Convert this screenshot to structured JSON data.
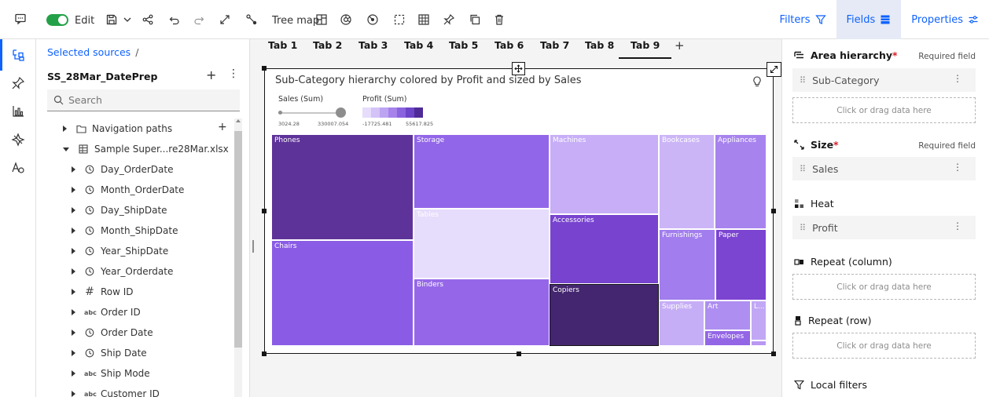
{
  "toolbar": {
    "edit_label": "Edit",
    "viz_type_label": "Tree map",
    "right_tabs": [
      {
        "label": "Filters",
        "icon": "filter-icon",
        "active": false
      },
      {
        "label": "Fields",
        "icon": "fields-icon",
        "active": true
      },
      {
        "label": "Properties",
        "icon": "properties-icon",
        "active": false
      }
    ]
  },
  "sources": {
    "title": "Selected sources",
    "separator": "/",
    "dataset_name": "SS_28Mar_DatePrep",
    "search_placeholder": "Search",
    "tree": [
      {
        "label": "Navigation paths",
        "icon": "folder-icon",
        "expanded": false,
        "level": 0
      },
      {
        "label": "Sample Super...re28Mar.xlsx",
        "icon": "table-icon",
        "expanded": true,
        "level": 0
      },
      {
        "label": "Day_OrderDate",
        "icon": "clock-icon",
        "level": 1
      },
      {
        "label": "Month_OrderDate",
        "icon": "clock-icon",
        "level": 1
      },
      {
        "label": "Day_ShipDate",
        "icon": "clock-icon",
        "level": 1
      },
      {
        "label": "Month_ShipDate",
        "icon": "clock-icon",
        "level": 1
      },
      {
        "label": "Year_ShipDate",
        "icon": "clock-icon",
        "level": 1
      },
      {
        "label": "Year_Orderdate",
        "icon": "clock-icon",
        "level": 1
      },
      {
        "label": "Row ID",
        "icon": "hash-icon",
        "level": 1
      },
      {
        "label": "Order ID",
        "icon": "abc-icon",
        "level": 1
      },
      {
        "label": "Order Date",
        "icon": "clock-icon",
        "level": 1
      },
      {
        "label": "Ship Date",
        "icon": "clock-icon",
        "level": 1
      },
      {
        "label": "Ship Mode",
        "icon": "abc-icon",
        "level": 1
      },
      {
        "label": "Customer ID",
        "icon": "abc-icon",
        "level": 1
      }
    ]
  },
  "tabs": {
    "items": [
      "Tab 1",
      "Tab 2",
      "Tab 3",
      "Tab 4",
      "Tab 5",
      "Tab 6",
      "Tab 7",
      "Tab 8",
      "Tab 9"
    ],
    "active": "Tab 9",
    "add_label": "+"
  },
  "visualization": {
    "title": "Sub-Category hierarchy colored by Profit and sized by Sales",
    "legend": {
      "size_title": "Sales (Sum)",
      "size_min": "3024.28",
      "size_max": "330007.054",
      "heat_title": "Profit (Sum)",
      "heat_min": "-17725.481",
      "heat_max": "55617.825",
      "heat_colors": [
        "#e6dcfb",
        "#d4c3f7",
        "#bda4f2",
        "#a583ea",
        "#8a63df",
        "#6d45c8",
        "#4e2b96"
      ]
    },
    "tiles": [
      {
        "label": "Phones",
        "color": "#5e3399"
      },
      {
        "label": "Chairs",
        "color": "#8a5ce6"
      },
      {
        "label": "Storage",
        "color": "#9266e8"
      },
      {
        "label": "Tables",
        "color": "#e6dcfb"
      },
      {
        "label": "Binders",
        "color": "#9567e8"
      },
      {
        "label": "Machines",
        "color": "#c7aef7"
      },
      {
        "label": "Accessories",
        "color": "#7743cf"
      },
      {
        "label": "Copiers",
        "color": "#43266f"
      },
      {
        "label": "Bookcases",
        "color": "#ccb5f7"
      },
      {
        "label": "Appliances",
        "color": "#a783ee"
      },
      {
        "label": "Furnishings",
        "color": "#a17ded"
      },
      {
        "label": "Paper",
        "color": "#7b44d1"
      },
      {
        "label": "Supplies",
        "color": "#c6aef6"
      },
      {
        "label": "Art",
        "color": "#ae8ef1"
      },
      {
        "label": "Envelopes",
        "color": "#9366e6"
      },
      {
        "label": "L...",
        "color": "#c2a7f5"
      },
      {
        "label": "",
        "color": "#b997f3"
      }
    ]
  },
  "fields_panel": {
    "sections": [
      {
        "title": "Area hierarchy",
        "required": true,
        "required_label": "Required field",
        "item": "Sub-Category",
        "icon": "area-hierarchy-icon"
      },
      {
        "title": "Size",
        "required": true,
        "required_label": "Required field",
        "item": "Sales",
        "icon": "size-icon"
      },
      {
        "title": "Heat",
        "required": false,
        "item": "Profit",
        "icon": "heat-icon"
      },
      {
        "title": "Repeat (column)",
        "required": false,
        "drop_label": "Click or drag data here",
        "icon": "repeat-column-icon"
      },
      {
        "title": "Repeat (row)",
        "required": false,
        "drop_label": "Click or drag data here",
        "icon": "repeat-row-icon"
      },
      {
        "title": "Local filters",
        "required": false,
        "icon": "filter-icon"
      }
    ],
    "area_drop_label": "Click or drag data here"
  }
}
